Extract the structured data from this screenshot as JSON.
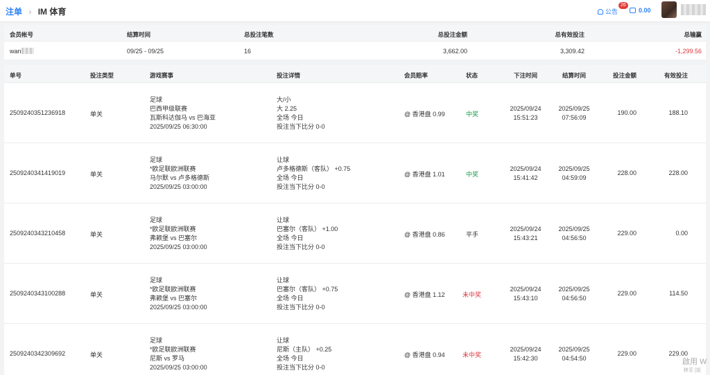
{
  "breadcrumb": {
    "parent": "注单",
    "separator": "›",
    "current": "IM 体育"
  },
  "header": {
    "notice_label": "公告",
    "notice_count": "26",
    "balance": "0.00"
  },
  "summary": {
    "headers": [
      "会员帐号",
      "结算时间",
      "总投注笔数",
      "总投注金额",
      "总有效投注",
      "总输赢"
    ],
    "account": "wan",
    "settle_range": "09/25 - 09/25",
    "bet_count": "16",
    "total_bet": "3,662.00",
    "total_valid": "3,309.42",
    "total_winloss": "-1,299.56"
  },
  "columns": [
    "单号",
    "投注类型",
    "游戏赛事",
    "投注详情",
    "会员赔率",
    "状态",
    "下注时间",
    "结算时间",
    "投注金额",
    "有效投注"
  ],
  "rows": [
    {
      "id": "2509240351236918",
      "type": "单关",
      "event": [
        "足球",
        "巴西甲级联赛",
        "瓦斯科达伽马 vs 巴海亚",
        "2025/09/25 06:30:00"
      ],
      "detail": [
        "大/小",
        "大 2.25",
        "全场 今日",
        "投注当下比分 0-0"
      ],
      "odds": "@ 香港盘 0.99",
      "status": "中奖",
      "status_kind": "ok",
      "bet_date": "2025/09/24",
      "bet_time": "15:51:23",
      "settle_date": "2025/09/25",
      "settle_time": "07:56:09",
      "amount": "190.00",
      "valid": "188.10"
    },
    {
      "id": "2509240341419019",
      "type": "单关",
      "event": [
        "足球",
        "*欧足联欧洲联赛",
        "马尔默 vs 卢多格德斯",
        "2025/09/25 03:00:00"
      ],
      "detail": [
        "让球",
        "卢多格德斯（客队） +0.75",
        "全场 今日",
        "投注当下比分 0-0"
      ],
      "odds": "@ 香港盘 1.01",
      "status": "中奖",
      "status_kind": "ok",
      "bet_date": "2025/09/24",
      "bet_time": "15:41:42",
      "settle_date": "2025/09/25",
      "settle_time": "04:59:09",
      "amount": "228.00",
      "valid": "228.00"
    },
    {
      "id": "2509240343210458",
      "type": "单关",
      "event": [
        "足球",
        "*欧足联欧洲联赛",
        "弗赖堡 vs 巴塞尔",
        "2025/09/25 03:00:00"
      ],
      "detail": [
        "让球",
        "巴塞尔（客队） +1.00",
        "全场 今日",
        "投注当下比分 0-0"
      ],
      "odds": "@ 香港盘 0.86",
      "status": "平手",
      "status_kind": "even",
      "bet_date": "2025/09/24",
      "bet_time": "15:43:21",
      "settle_date": "2025/09/25",
      "settle_time": "04:56:50",
      "amount": "229.00",
      "valid": "0.00"
    },
    {
      "id": "2509240343100288",
      "type": "单关",
      "event": [
        "足球",
        "*欧足联欧洲联赛",
        "弗赖堡 vs 巴塞尔",
        "2025/09/25 03:00:00"
      ],
      "detail": [
        "让球",
        "巴塞尔（客队） +0.75",
        "全场 今日",
        "投注当下比分 0-0"
      ],
      "odds": "@ 香港盘 1.12",
      "status": "未中奖",
      "status_kind": "lost",
      "bet_date": "2025/09/24",
      "bet_time": "15:43:10",
      "settle_date": "2025/09/25",
      "settle_time": "04:56:50",
      "amount": "229.00",
      "valid": "114.50"
    },
    {
      "id": "2509240342309692",
      "type": "单关",
      "event": [
        "足球",
        "*欧足联欧洲联赛",
        "尼斯 vs 罗马",
        "2025/09/25 03:00:00"
      ],
      "detail": [
        "让球",
        "尼斯（主队） +0.25",
        "全场 今日",
        "投注当下比分 0-0"
      ],
      "odds": "@ 香港盘 0.94",
      "status": "未中奖",
      "status_kind": "lost",
      "bet_date": "2025/09/24",
      "bet_time": "15:42:30",
      "settle_date": "2025/09/25",
      "settle_time": "04:54:50",
      "amount": "229.00",
      "valid": "229.00"
    }
  ],
  "watermark": {
    "line1": "啟用 W",
    "line2": "移至 [設"
  }
}
